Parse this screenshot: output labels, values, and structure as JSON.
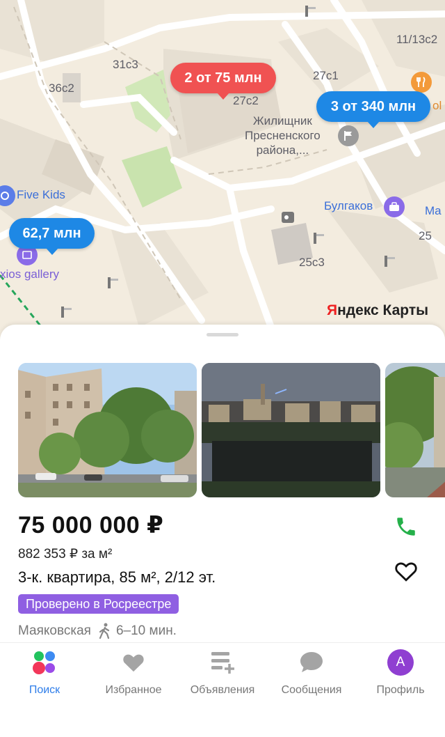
{
  "map": {
    "brand": {
      "prefix": "Я",
      "rest": "ндекс Карты"
    },
    "pins": [
      {
        "text": "2 от 75 млн",
        "color": "#f05252"
      },
      {
        "text": "3 от 340 млн",
        "color": "#1e88e5"
      },
      {
        "text": "62,7 млн",
        "color": "#1e88e5"
      }
    ],
    "labels": {
      "b36c2": "36с2",
      "b31c3": "31с3",
      "b27c1": "27с1",
      "b27c2": "27с2",
      "b11_13c2": "11/13с2",
      "b25": "25",
      "b25c3": "25с3",
      "zhil_1": "Жилищник",
      "zhil_2": "Пресненского",
      "zhil_3": "района,...",
      "five_kids": "Five Kids",
      "gallery": "xios gallery",
      "bulgakov": "Булгаков",
      "ma": "Ma",
      "ol": "ol"
    }
  },
  "listing": {
    "price": "75 000 000 ₽",
    "price_per_m": "882 353 ₽ за м²",
    "description": "3-к. квартира, 85 м², 2/12 эт.",
    "badge": "Проверено в Росреестре",
    "metro": "Маяковская",
    "walk_time": "6–10 мин.",
    "accent_color": "#8f5fe2"
  },
  "tabs": [
    {
      "label": "Поиск",
      "icon": "search-dots-icon",
      "active": true
    },
    {
      "label": "Избранное",
      "icon": "heart-icon",
      "active": false
    },
    {
      "label": "Объявления",
      "icon": "listings-icon",
      "active": false
    },
    {
      "label": "Сообщения",
      "icon": "message-icon",
      "active": false
    },
    {
      "label": "Профиль",
      "icon": "avatar",
      "avatar_letter": "A",
      "active": false
    }
  ]
}
